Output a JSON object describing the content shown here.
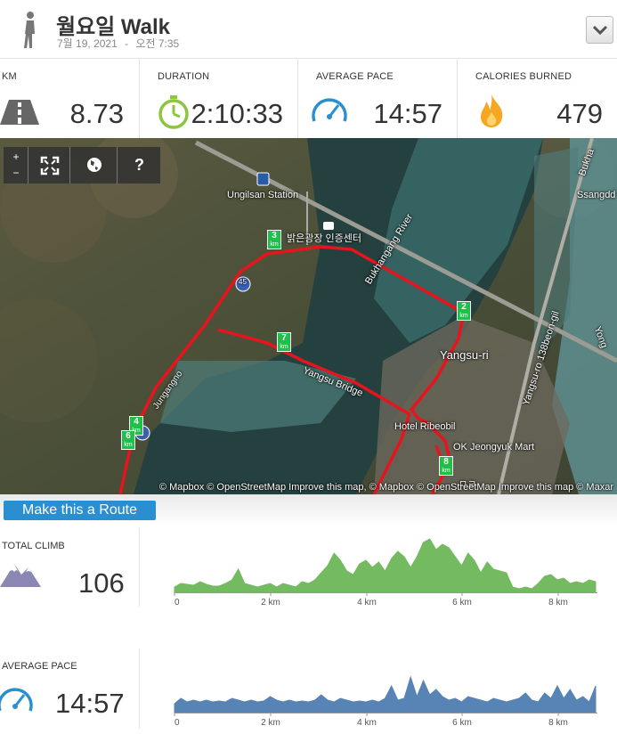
{
  "header": {
    "title": "월요일 Walk",
    "subtitle_date": "7월 19, 2021",
    "subtitle_sep": "-",
    "subtitle_time": "오전 7:35"
  },
  "stats": [
    {
      "label": "KM",
      "value": "8.73",
      "icon": "road-icon"
    },
    {
      "label": "DURATION",
      "value": "2:10:33",
      "icon": "stopwatch-icon"
    },
    {
      "label": "AVERAGE PACE",
      "value": "14:57",
      "icon": "speedometer-icon"
    },
    {
      "label": "CALORIES BURNED",
      "value": "479",
      "icon": "flame-icon"
    }
  ],
  "map": {
    "controls": {
      "zoom_in": "+",
      "zoom_out": "−",
      "fullscreen": "fullscreen-icon",
      "globe": "globe-icon",
      "help": "?"
    },
    "labels": {
      "station": "Ungilsan Station",
      "center": "밝은광장 인증센터",
      "river": "Bukhangang River",
      "town": "Yangsu-ri",
      "bridge": "Yangsu Bridge",
      "hotel": "Hotel Ribeobil",
      "mart": "OK Jeongyuk Mart",
      "road": "Yangsu-ro 138beon-gil",
      "ssang": "Ssangdd",
      "bukh": "Bukha",
      "yong": "Yong",
      "route45": "45",
      "left_road": "Jungangno",
      "poi_bottom": "ㅁㄹ"
    },
    "km_markers": [
      "2",
      "3",
      "4",
      "6",
      "7",
      "8"
    ],
    "km_unit": "km",
    "attribution": "© Mapbox © OpenStreetMap Improve this map, © Mapbox © OpenStreetMap Improve this map © Maxar"
  },
  "route_button": "Make this a Route",
  "climb": {
    "label": "TOTAL CLIMB",
    "value": "106",
    "icon": "mountain-icon",
    "color": "#5cae45",
    "ticks": [
      "0",
      "2 km",
      "4 km",
      "6 km",
      "8 km"
    ]
  },
  "pace": {
    "label": "AVERAGE PACE",
    "value": "14:57",
    "icon": "speedometer-icon",
    "color": "#3a6fa8",
    "ticks": [
      "0",
      "2 km",
      "4 km",
      "6 km",
      "8 km"
    ]
  },
  "colors": {
    "accent_blue": "#2a8fd0",
    "route_red": "#e8141d",
    "marker_green": "#1fbf4a"
  }
}
